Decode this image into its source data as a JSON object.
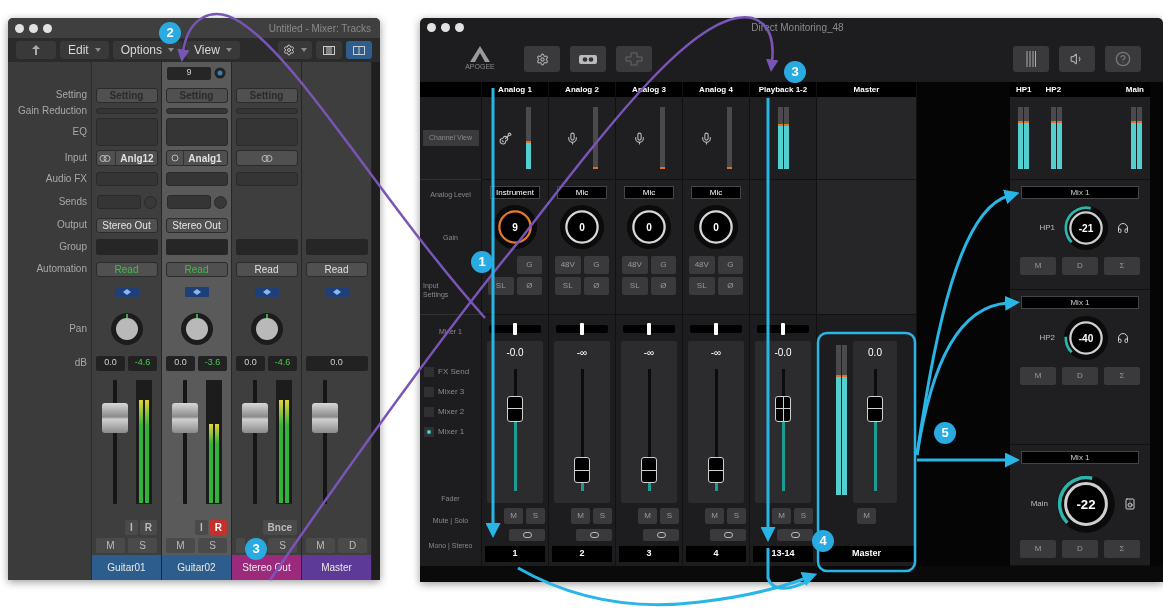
{
  "mixer_window": {
    "title": "Untitled - Mixer: Tracks",
    "menus": [
      "Edit",
      "Options",
      "View"
    ],
    "view_modes": [
      {
        "selected": false
      },
      {
        "selected": true
      }
    ],
    "row_labels": {
      "setting": "Setting",
      "gain_reduction": "Gain Reduction",
      "eq": "EQ",
      "input": "Input",
      "audio_fx": "Audio FX",
      "sends": "Sends",
      "output": "Output",
      "group": "Group",
      "automation": "Automation",
      "pan": "Pan",
      "db": "dB"
    },
    "strips": [
      {
        "kind": "track",
        "name": "Guitar01",
        "color": "#2d5d8c",
        "selected": false,
        "setting": "Setting",
        "input": {
          "kind": "stereo",
          "label": "Anlg12"
        },
        "output": "Stereo Out",
        "automation": "Read",
        "automation_active": true,
        "volume": "0.0",
        "peak": "-4.6",
        "meter": {
          "level": 0.84
        },
        "fader": {
          "level": 0.76
        },
        "buttons": [
          {
            "label": "I",
            "on": false
          },
          {
            "label": "R",
            "on": false
          }
        ],
        "mute": "M",
        "solo": "S"
      },
      {
        "kind": "track",
        "name": "Guitar02",
        "color": "#2d5d8c",
        "selected": true,
        "track_number": "9",
        "setting": "Setting",
        "input": {
          "kind": "mono",
          "label": "Analg1"
        },
        "output": "Stereo Out",
        "automation": "Read",
        "automation_active": true,
        "volume": "0.0",
        "peak": "-3.6",
        "meter": {
          "level": 0.64
        },
        "fader": {
          "level": 0.76
        },
        "buttons": [
          {
            "label": "I",
            "on": false
          },
          {
            "label": "R",
            "on": true
          }
        ],
        "mute": "M",
        "solo": "S"
      },
      {
        "kind": "output",
        "name": "Stereo Out",
        "color": "#9b2a7c",
        "selected": false,
        "setting": "Setting",
        "input": {
          "kind": "stereo"
        },
        "automation": "Read",
        "automation_active": false,
        "volume": "0.0",
        "peak": "-4.6",
        "meter": {
          "level": 0.84
        },
        "fader": {
          "level": 0.76
        },
        "buttons": [
          {
            "label": "Bnce",
            "on": false
          }
        ],
        "solo": "S"
      },
      {
        "kind": "master",
        "name": "Master",
        "color": "#5e3a98",
        "selected": false,
        "automation": "Read",
        "automation_active": false,
        "volume": "0.0",
        "fader": {
          "level": 0.76
        },
        "mute": "M",
        "solo": "D"
      }
    ]
  },
  "monitor_window": {
    "title": "Direct Monitoring_48",
    "logo": "APOGEE",
    "row_labels": {
      "channel_view": "Channel View",
      "analog_level": "Analog Level",
      "gain": "Gain",
      "input_settings": "Input Settings",
      "mixer": "Mixer 1",
      "fader": "Fader",
      "mute_solo": "Mute | Solo",
      "mono_stereo": "Mono | Stereo"
    },
    "mixers": [
      {
        "label": "FX Send",
        "selected": false
      },
      {
        "label": "Mixer 3",
        "selected": false
      },
      {
        "label": "Mixer 2",
        "selected": false
      },
      {
        "label": "Mixer 1",
        "selected": true
      }
    ],
    "channels": [
      {
        "kind": "analog",
        "name": "Analog 1",
        "icon": {
          "kind": "guitar"
        },
        "meter": {
          "level": 0.45
        },
        "analog_level": "Instrument",
        "gain": "9",
        "gain_active": true,
        "input_buttons": [
          "G",
          "SL",
          "Ø"
        ],
        "pan": {
          "level": 0.5
        },
        "readout": "-0.0",
        "fader": {
          "level": 0.72
        },
        "mute": "M",
        "solo": "S",
        "footer": "1"
      },
      {
        "kind": "analog",
        "name": "Analog 2",
        "icon": {
          "kind": "mic"
        },
        "meter": {
          "level": 0
        },
        "analog_level": "Mic",
        "gain": "0",
        "gain_active": false,
        "input_buttons": [
          "48V",
          "G",
          "SL",
          "Ø"
        ],
        "pan": {
          "level": 0.5
        },
        "readout": "-∞",
        "fader": {
          "level": 0.08
        },
        "mute": "M",
        "solo": "S",
        "footer": "2"
      },
      {
        "kind": "analog",
        "name": "Analog 3",
        "icon": {
          "kind": "mic"
        },
        "meter": {
          "level": 0
        },
        "analog_level": "Mic",
        "gain": "0",
        "gain_active": false,
        "input_buttons": [
          "48V",
          "G",
          "SL",
          "Ø"
        ],
        "pan": {
          "level": 0.5
        },
        "readout": "-∞",
        "fader": {
          "level": 0.08
        },
        "mute": "M",
        "solo": "S",
        "footer": "3"
      },
      {
        "kind": "analog",
        "name": "Analog 4",
        "icon": {
          "kind": "mic"
        },
        "meter": {
          "level": 0
        },
        "analog_level": "Mic",
        "gain": "0",
        "gain_active": false,
        "input_buttons": [
          "48V",
          "G",
          "SL",
          "Ø"
        ],
        "pan": {
          "level": 0.5
        },
        "readout": "-∞",
        "fader": {
          "level": 0.08
        },
        "mute": "M",
        "solo": "S",
        "footer": "4"
      },
      {
        "kind": "playback",
        "name": "Playback 1-2",
        "meter": {
          "level": 0.72
        },
        "pan": {
          "level": 0.5
        },
        "readout": "-0.0",
        "fader": {
          "level": 0.72
        },
        "mute": "M",
        "solo": "S",
        "footer": "13-14"
      },
      {
        "kind": "master",
        "name": "Master",
        "meter": {
          "level": 0.8
        },
        "readout": "0.0",
        "fader": {
          "level": 0.72
        },
        "mute": "M",
        "footer": "Master"
      }
    ],
    "output_meters": [
      {
        "label": "HP1",
        "level": 0.78
      },
      {
        "label": "HP2",
        "level": 0.78
      },
      {
        "label": "Main",
        "level": 0.78
      }
    ],
    "outputs": [
      {
        "kind": "headphones",
        "mix": "Mix 1",
        "label": "HP1",
        "value": "-21",
        "level": 0.55,
        "buttons": [
          "M",
          "D",
          "Σ"
        ]
      },
      {
        "kind": "headphones",
        "mix": "Mix 1",
        "label": "HP2",
        "value": "-40",
        "level": 0.18,
        "buttons": [
          "M",
          "D",
          "Σ"
        ]
      },
      {
        "kind": "speaker",
        "mix": "Mix 1",
        "label": "Main",
        "value": "-22",
        "level": 0.55,
        "buttons": [
          "M",
          "D",
          "Σ"
        ]
      }
    ]
  },
  "callouts": [
    {
      "label": "2"
    },
    {
      "label": "3"
    },
    {
      "label": "1"
    },
    {
      "label": "5"
    },
    {
      "label": "4"
    },
    {
      "label": "3"
    }
  ]
}
